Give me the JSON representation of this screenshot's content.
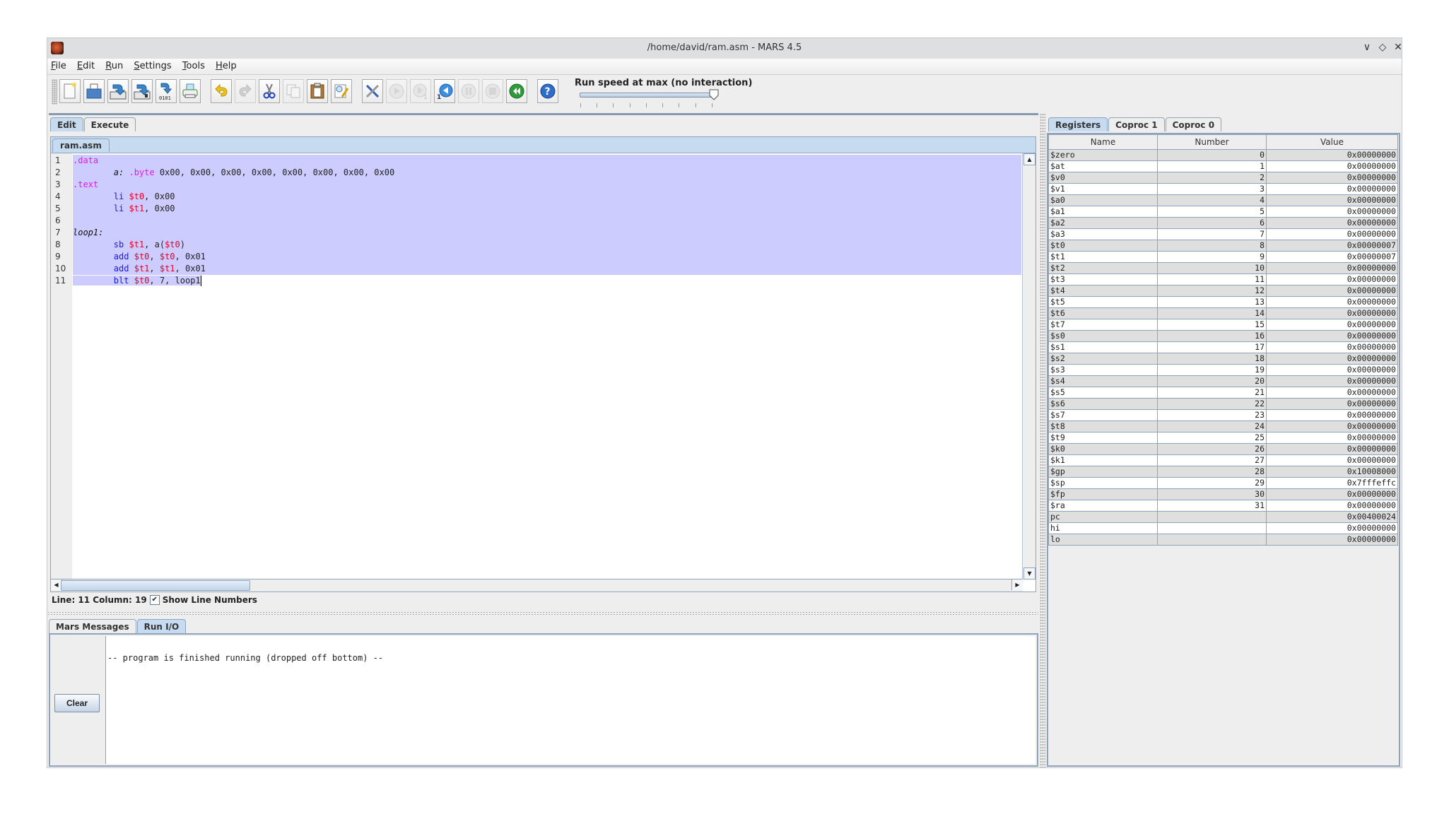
{
  "window": {
    "title": "/home/david/ram.asm - MARS 4.5",
    "controls": [
      "minimize",
      "maximize",
      "close"
    ],
    "control_glyphs": [
      "∨",
      "◇",
      "✕"
    ]
  },
  "menu": [
    {
      "label": "File",
      "mnemonic": "F",
      "rest": "ile"
    },
    {
      "label": "Edit",
      "mnemonic": "E",
      "rest": "dit"
    },
    {
      "label": "Run",
      "mnemonic": "R",
      "rest": "un"
    },
    {
      "label": "Settings",
      "mnemonic": "S",
      "rest": "ettings"
    },
    {
      "label": "Tools",
      "mnemonic": "T",
      "rest": "ools"
    },
    {
      "label": "Help",
      "mnemonic": "H",
      "rest": "elp"
    }
  ],
  "toolbar": {
    "buttons": [
      {
        "name": "new-file",
        "enabled": true
      },
      {
        "name": "open-file",
        "enabled": true
      },
      {
        "name": "save",
        "enabled": true
      },
      {
        "name": "save-as",
        "enabled": true
      },
      {
        "name": "dump-memory",
        "enabled": true,
        "text": "0101"
      },
      {
        "name": "print",
        "enabled": true
      },
      {
        "name": "undo",
        "enabled": true
      },
      {
        "name": "redo",
        "enabled": false
      },
      {
        "name": "cut",
        "enabled": true
      },
      {
        "name": "copy",
        "enabled": false
      },
      {
        "name": "paste",
        "enabled": true
      },
      {
        "name": "find-replace",
        "enabled": true
      },
      {
        "name": "assemble",
        "enabled": true
      },
      {
        "name": "run",
        "enabled": false
      },
      {
        "name": "step",
        "enabled": false
      },
      {
        "name": "backstep",
        "enabled": true
      },
      {
        "name": "pause",
        "enabled": false
      },
      {
        "name": "stop",
        "enabled": false
      },
      {
        "name": "reset",
        "enabled": true
      },
      {
        "name": "help",
        "enabled": true
      }
    ],
    "speed_label": "Run speed at max (no interaction)",
    "speed_value_fraction": 1.0
  },
  "editor": {
    "tabs": [
      {
        "label": "Edit",
        "active": true
      },
      {
        "label": "Execute",
        "active": false
      }
    ],
    "file_tab": "ram.asm",
    "lines": [
      {
        "n": "1",
        "tokens": [
          {
            "t": ".data",
            "c": "kw-dir"
          }
        ],
        "selected": true
      },
      {
        "n": "2",
        "tokens": [
          {
            "t": "        "
          },
          {
            "t": "a:",
            "c": "kw-lbl"
          },
          {
            "t": " "
          },
          {
            "t": ".byte",
            "c": "kw-dir"
          },
          {
            "t": " 0x00, 0x00, 0x00, 0x00, 0x00, 0x00, 0x00, 0x00"
          }
        ],
        "selected": true
      },
      {
        "n": "3",
        "tokens": [
          {
            "t": ".text",
            "c": "kw-dir"
          }
        ],
        "selected": true
      },
      {
        "n": "4",
        "tokens": [
          {
            "t": "        "
          },
          {
            "t": "li",
            "c": "kw-op"
          },
          {
            "t": " "
          },
          {
            "t": "$t0",
            "c": "kw-reg"
          },
          {
            "t": ", 0x00"
          }
        ],
        "selected": true
      },
      {
        "n": "5",
        "tokens": [
          {
            "t": "        "
          },
          {
            "t": "li",
            "c": "kw-op"
          },
          {
            "t": " "
          },
          {
            "t": "$t1",
            "c": "kw-reg"
          },
          {
            "t": ", 0x00"
          }
        ],
        "selected": true
      },
      {
        "n": "6",
        "tokens": [],
        "selected": true
      },
      {
        "n": "7",
        "tokens": [
          {
            "t": "loop1:",
            "c": "kw-lbl"
          }
        ],
        "selected": true
      },
      {
        "n": "8",
        "tokens": [
          {
            "t": "        "
          },
          {
            "t": "sb",
            "c": "kw-op"
          },
          {
            "t": " "
          },
          {
            "t": "$t1",
            "c": "kw-reg"
          },
          {
            "t": ", a("
          },
          {
            "t": "$t0",
            "c": "kw-reg"
          },
          {
            "t": ")"
          }
        ],
        "selected": true
      },
      {
        "n": "9",
        "tokens": [
          {
            "t": "        "
          },
          {
            "t": "add",
            "c": "kw-op"
          },
          {
            "t": " "
          },
          {
            "t": "$t0",
            "c": "kw-reg"
          },
          {
            "t": ", "
          },
          {
            "t": "$t0",
            "c": "kw-reg"
          },
          {
            "t": ", 0x01"
          }
        ],
        "selected": true
      },
      {
        "n": "10",
        "tokens": [
          {
            "t": "        "
          },
          {
            "t": "add",
            "c": "kw-op"
          },
          {
            "t": " "
          },
          {
            "t": "$t1",
            "c": "kw-reg"
          },
          {
            "t": ", "
          },
          {
            "t": "$t1",
            "c": "kw-reg"
          },
          {
            "t": ", 0x01"
          }
        ],
        "selected": true
      },
      {
        "n": "11",
        "tokens": [
          {
            "t": "        "
          },
          {
            "t": "blt",
            "c": "kw-op"
          },
          {
            "t": " "
          },
          {
            "t": "$t0",
            "c": "kw-reg"
          },
          {
            "t": ", 7, loop1"
          }
        ],
        "selected": "partial",
        "caret": true
      }
    ],
    "status": "Line: 11 Column: 19",
    "show_line_numbers_label": "Show Line Numbers",
    "show_line_numbers_checked": true,
    "colors": {
      "directive": "#f011f0",
      "operator": "#1a1ad6",
      "register": "#e8002a",
      "selection": "#ccccff"
    }
  },
  "messages": {
    "tabs": [
      {
        "label": "Mars Messages",
        "active": false
      },
      {
        "label": "Run I/O",
        "active": true
      }
    ],
    "clear_label": "Clear",
    "output": "-- program is finished running (dropped off bottom) --"
  },
  "registers": {
    "tabs": [
      {
        "label": "Registers",
        "active": true
      },
      {
        "label": "Coproc 1",
        "active": false
      },
      {
        "label": "Coproc 0",
        "active": false
      }
    ],
    "columns": [
      "Name",
      "Number",
      "Value"
    ],
    "rows": [
      [
        "$zero",
        "0",
        "0x00000000"
      ],
      [
        "$at",
        "1",
        "0x00000000"
      ],
      [
        "$v0",
        "2",
        "0x00000000"
      ],
      [
        "$v1",
        "3",
        "0x00000000"
      ],
      [
        "$a0",
        "4",
        "0x00000000"
      ],
      [
        "$a1",
        "5",
        "0x00000000"
      ],
      [
        "$a2",
        "6",
        "0x00000000"
      ],
      [
        "$a3",
        "7",
        "0x00000000"
      ],
      [
        "$t0",
        "8",
        "0x00000007"
      ],
      [
        "$t1",
        "9",
        "0x00000007"
      ],
      [
        "$t2",
        "10",
        "0x00000000"
      ],
      [
        "$t3",
        "11",
        "0x00000000"
      ],
      [
        "$t4",
        "12",
        "0x00000000"
      ],
      [
        "$t5",
        "13",
        "0x00000000"
      ],
      [
        "$t6",
        "14",
        "0x00000000"
      ],
      [
        "$t7",
        "15",
        "0x00000000"
      ],
      [
        "$s0",
        "16",
        "0x00000000"
      ],
      [
        "$s1",
        "17",
        "0x00000000"
      ],
      [
        "$s2",
        "18",
        "0x00000000"
      ],
      [
        "$s3",
        "19",
        "0x00000000"
      ],
      [
        "$s4",
        "20",
        "0x00000000"
      ],
      [
        "$s5",
        "21",
        "0x00000000"
      ],
      [
        "$s6",
        "22",
        "0x00000000"
      ],
      [
        "$s7",
        "23",
        "0x00000000"
      ],
      [
        "$t8",
        "24",
        "0x00000000"
      ],
      [
        "$t9",
        "25",
        "0x00000000"
      ],
      [
        "$k0",
        "26",
        "0x00000000"
      ],
      [
        "$k1",
        "27",
        "0x00000000"
      ],
      [
        "$gp",
        "28",
        "0x10008000"
      ],
      [
        "$sp",
        "29",
        "0x7fffeffc"
      ],
      [
        "$fp",
        "30",
        "0x00000000"
      ],
      [
        "$ra",
        "31",
        "0x00000000"
      ],
      [
        "pc",
        "",
        "0x00400024"
      ],
      [
        "hi",
        "",
        "0x00000000"
      ],
      [
        "lo",
        "",
        "0x00000000"
      ]
    ]
  }
}
